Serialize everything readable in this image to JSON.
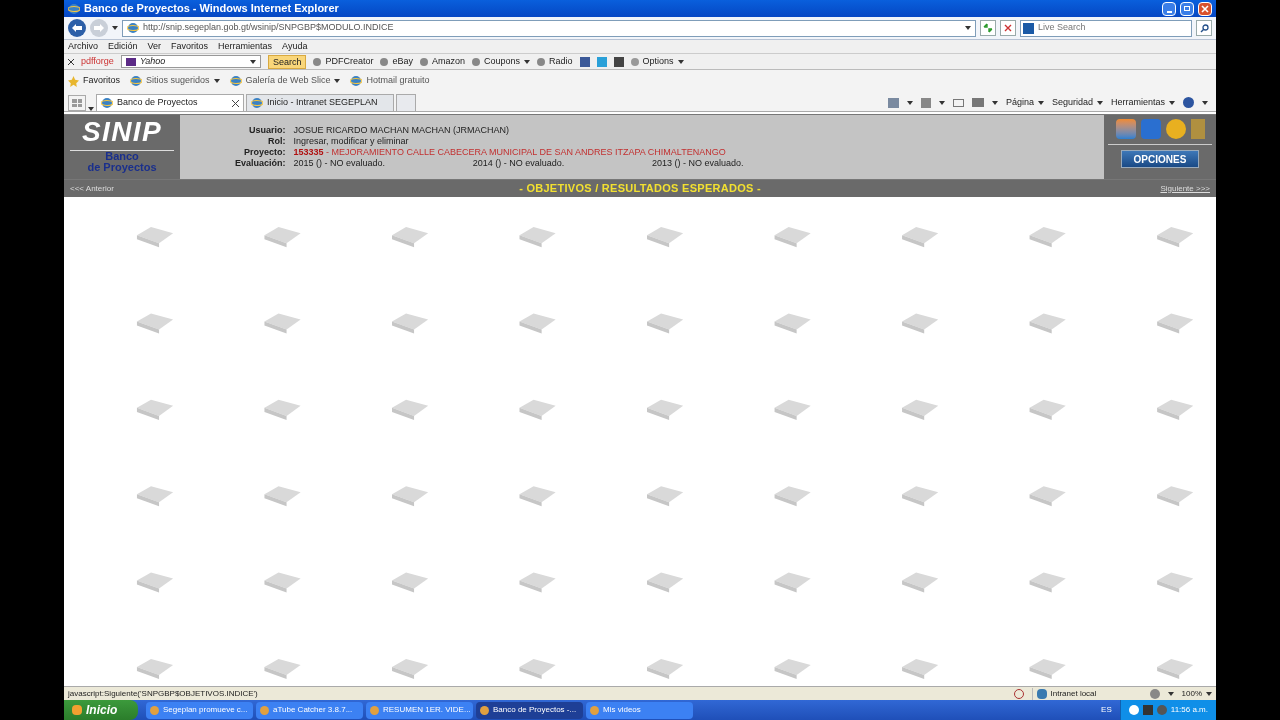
{
  "window": {
    "title": "Banco de Proyectos - Windows Internet Explorer"
  },
  "address": {
    "url": "http://snip.segeplan.gob.gt/wsinip/SNPGBP$MODULO.INDICE"
  },
  "search": {
    "placeholder": "Live Search"
  },
  "menu": [
    "Archivo",
    "Edición",
    "Ver",
    "Favoritos",
    "Herramientas",
    "Ayuda"
  ],
  "toolbar": {
    "brand": "pdfforge",
    "search_value": "Yahoo",
    "search_button": "Search",
    "items": [
      {
        "label": "PDFCreator",
        "dropdown": false
      },
      {
        "label": "eBay",
        "dropdown": false
      },
      {
        "label": "Amazon",
        "dropdown": false
      },
      {
        "label": "Coupons",
        "dropdown": true
      },
      {
        "label": "Radio",
        "dropdown": false
      }
    ],
    "options": "Options"
  },
  "favorites": {
    "label": "Favoritos",
    "items": [
      {
        "label": "Sitios sugeridos",
        "dropdown": true
      },
      {
        "label": "Galería de Web Slice",
        "dropdown": true
      },
      {
        "label": "Hotmail gratuito",
        "dropdown": false
      }
    ]
  },
  "tabs": [
    {
      "label": "Banco de Proyectos",
      "selected": true
    },
    {
      "label": "Inicio - Intranet SEGEPLAN",
      "selected": false
    }
  ],
  "command_bar": [
    "Página",
    "Seguridad",
    "Herramientas"
  ],
  "page": {
    "logo": "SINIP",
    "subtitle": [
      "Banco",
      "de Proyectos"
    ],
    "fields": [
      {
        "label": "Usuario:",
        "value": "JOSUE RICARDO MACHAN MACHAN (JRMACHAN)"
      },
      {
        "label": "Rol:",
        "value": "Ingresar, modificar y eliminar"
      },
      {
        "label": "Proyecto:",
        "code": "153335",
        "value": " - MEJORAMIENTO CALLE CABECERA MUNICIPAL DE SAN ANDRES ITZAPA CHIMALTENANGO"
      }
    ],
    "evaluation_label": "Evaluación:",
    "evaluations": [
      "2015 () - NO evaluado.",
      "2014 () - NO evaluado.",
      "2013 () - NO evaluado."
    ],
    "options_button": "OPCIONES",
    "previous": "<<< Anterior",
    "section_title": "- OBJETIVOS / RESULTADOS ESPERADOS -",
    "next": "Siguiente >>>"
  },
  "status_bar": {
    "text": "javascript:Siguiente('SNPGBP$OBJETIVOS.INDICE')",
    "zone": "Intranet local",
    "zoom": "100%"
  },
  "taskbar": {
    "start": "Inicio",
    "items": [
      {
        "label": "Segeplan promueve c...",
        "selected": false
      },
      {
        "label": "aTube Catcher 3.8.7...",
        "selected": false
      },
      {
        "label": "RESUMEN 1ER. VIDE...",
        "selected": false
      },
      {
        "label": "Banco de Proyectos -...",
        "selected": true
      },
      {
        "label": "Mis videos",
        "selected": false
      }
    ],
    "language": "ES",
    "clock": "11:56 a.m."
  }
}
